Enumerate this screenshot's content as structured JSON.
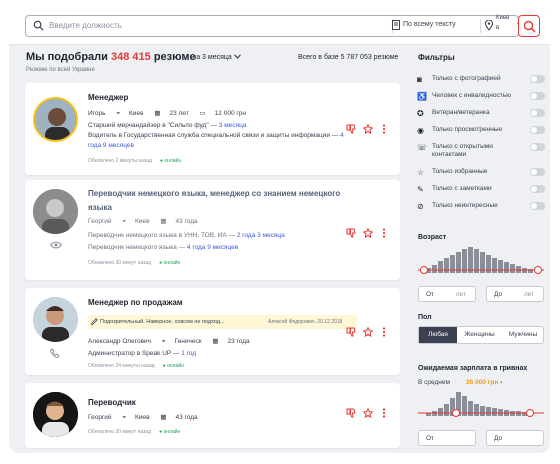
{
  "search": {
    "placeholder": "Введите должность",
    "scope": "По всему тексту",
    "city_label": "Киев",
    "city_value": "в"
  },
  "header": {
    "prefix": "Мы подобрали",
    "count": "348 415",
    "suffix": "резюме",
    "period": "за 3 месяца",
    "total": "Всего в базе 5 787 053 резюме",
    "sub": "Резюме по всей Украине"
  },
  "cards": [
    {
      "title": "Менеджер",
      "name": "Игорь",
      "city": "Киев",
      "age": "23 лет",
      "salary": "12 000 грн",
      "exp": [
        {
          "text": "Старший мерчандайзер в \"Сильпо фуд\"",
          "dur": "3 месяца"
        },
        {
          "text": "Водитель в Государственная служба специальной связи и защиты информации",
          "dur": "4 года 9 месяцев"
        }
      ],
      "updated": "Обновлено 2 минуты назад",
      "online": "онлайн"
    },
    {
      "title": "Переводчик немецкого языка, менеджер со знанием немецкого языка",
      "name": "Георгий",
      "city": "Киев",
      "age": "43 года",
      "exp": [
        {
          "text": "Переводчик немецкого языка в УНН, ТОВ, ИА",
          "dur": "2 года 3 месяца"
        },
        {
          "text": "Переводчик немецкого языка",
          "dur": "4 года 9 месяцев"
        }
      ],
      "updated": "Обновлено 30 минут назад",
      "online": "онлайн"
    },
    {
      "title": "Менеджер по продажам",
      "note": "Подозрительный. Наверное, совсем не подход...",
      "note_author": "Алексей Федорович, 20.12.2018",
      "name": "Александр Олегович",
      "city": "Геническ",
      "age": "23 года",
      "exp": [
        {
          "text": "Администратор в Speak UP",
          "dur": "1 год"
        }
      ],
      "updated": "Обновлено 34 минуты назад",
      "online": "онлайн"
    },
    {
      "title": "Переводчик",
      "name": "Георгий",
      "city": "Киев",
      "age": "43 года",
      "updated": "Обновлено 20 минут назад",
      "online": "онлайн"
    }
  ],
  "filters": {
    "title": "Фильтры",
    "toggles": [
      {
        "icon": "camera-icon",
        "label": "Только с фотографией"
      },
      {
        "icon": "wheelchair-icon",
        "label": "Человек с инвалидностью"
      },
      {
        "icon": "medal-icon",
        "label": "Ветеран/ветеранка"
      },
      {
        "icon": "eye-icon",
        "label": "Только просмотренные"
      },
      {
        "icon": "contacts-icon",
        "label": "Только с открытыми контактами"
      },
      {
        "icon": "star-icon",
        "label": "Только избранные"
      },
      {
        "icon": "pencil-icon",
        "label": "Только с заметками"
      },
      {
        "icon": "thumb-down-icon",
        "label": "Только неинтересные"
      }
    ],
    "age": {
      "title": "Возраст",
      "from": "От",
      "from_unit": "лет",
      "to": "До",
      "to_unit": "лет"
    },
    "gender": {
      "title": "Пол",
      "options": [
        "Любая",
        "Женщины",
        "Мужчины"
      ],
      "selected": "Любая"
    },
    "salary": {
      "title": "Ожидаемая зарплата в гривнах",
      "avg_label": "В среднем",
      "avg_value": "26 000 грн",
      "from": "От",
      "to": "До"
    }
  },
  "colors": {
    "accent": "#e53935",
    "link": "#3b5bd9",
    "online": "#20a35c",
    "salary": "#f39c12"
  }
}
